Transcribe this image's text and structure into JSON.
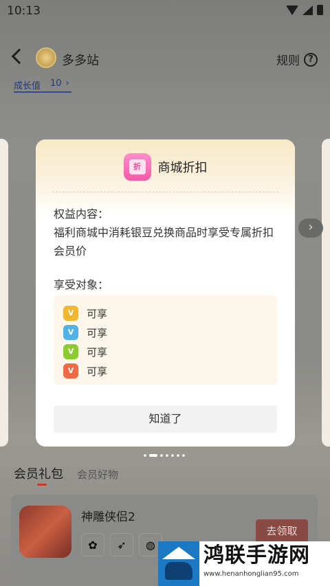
{
  "status_bar": {
    "time": "10:13"
  },
  "nav": {
    "title": "多多站",
    "rules_label": "规则",
    "help_glyph": "?"
  },
  "growth": {
    "label": "成长值",
    "value": "10",
    "arrow": "›"
  },
  "card": {
    "icon_glyph": "折",
    "title": "商城折扣",
    "benefit_label": "权益内容：",
    "benefit_text": "福利商城中消耗银豆兑换商品时享受专属折扣会员价",
    "audience_label": "享受对象：",
    "audience": [
      {
        "icon": "gold-tier-icon",
        "glyph": "V",
        "color": "#f2b730",
        "label": "可享"
      },
      {
        "icon": "blue-tier-icon",
        "glyph": "V",
        "color": "#4fb3e8",
        "label": "可享"
      },
      {
        "icon": "green-tier-icon",
        "glyph": "V",
        "color": "#8ccb2f",
        "label": "可享"
      },
      {
        "icon": "red-tier-icon",
        "glyph": "V",
        "color": "#ef6a45",
        "label": "可享"
      }
    ],
    "ok_label": "知道了"
  },
  "next_arrow": "›",
  "tabs": {
    "active": "会员礼包",
    "other": "会员好物"
  },
  "gift": {
    "game_name": "神雕侠侣2",
    "claim_label": "去领取"
  },
  "watermark": {
    "title": "鸿联手游网",
    "url": "www.henanhonglian95.com"
  }
}
